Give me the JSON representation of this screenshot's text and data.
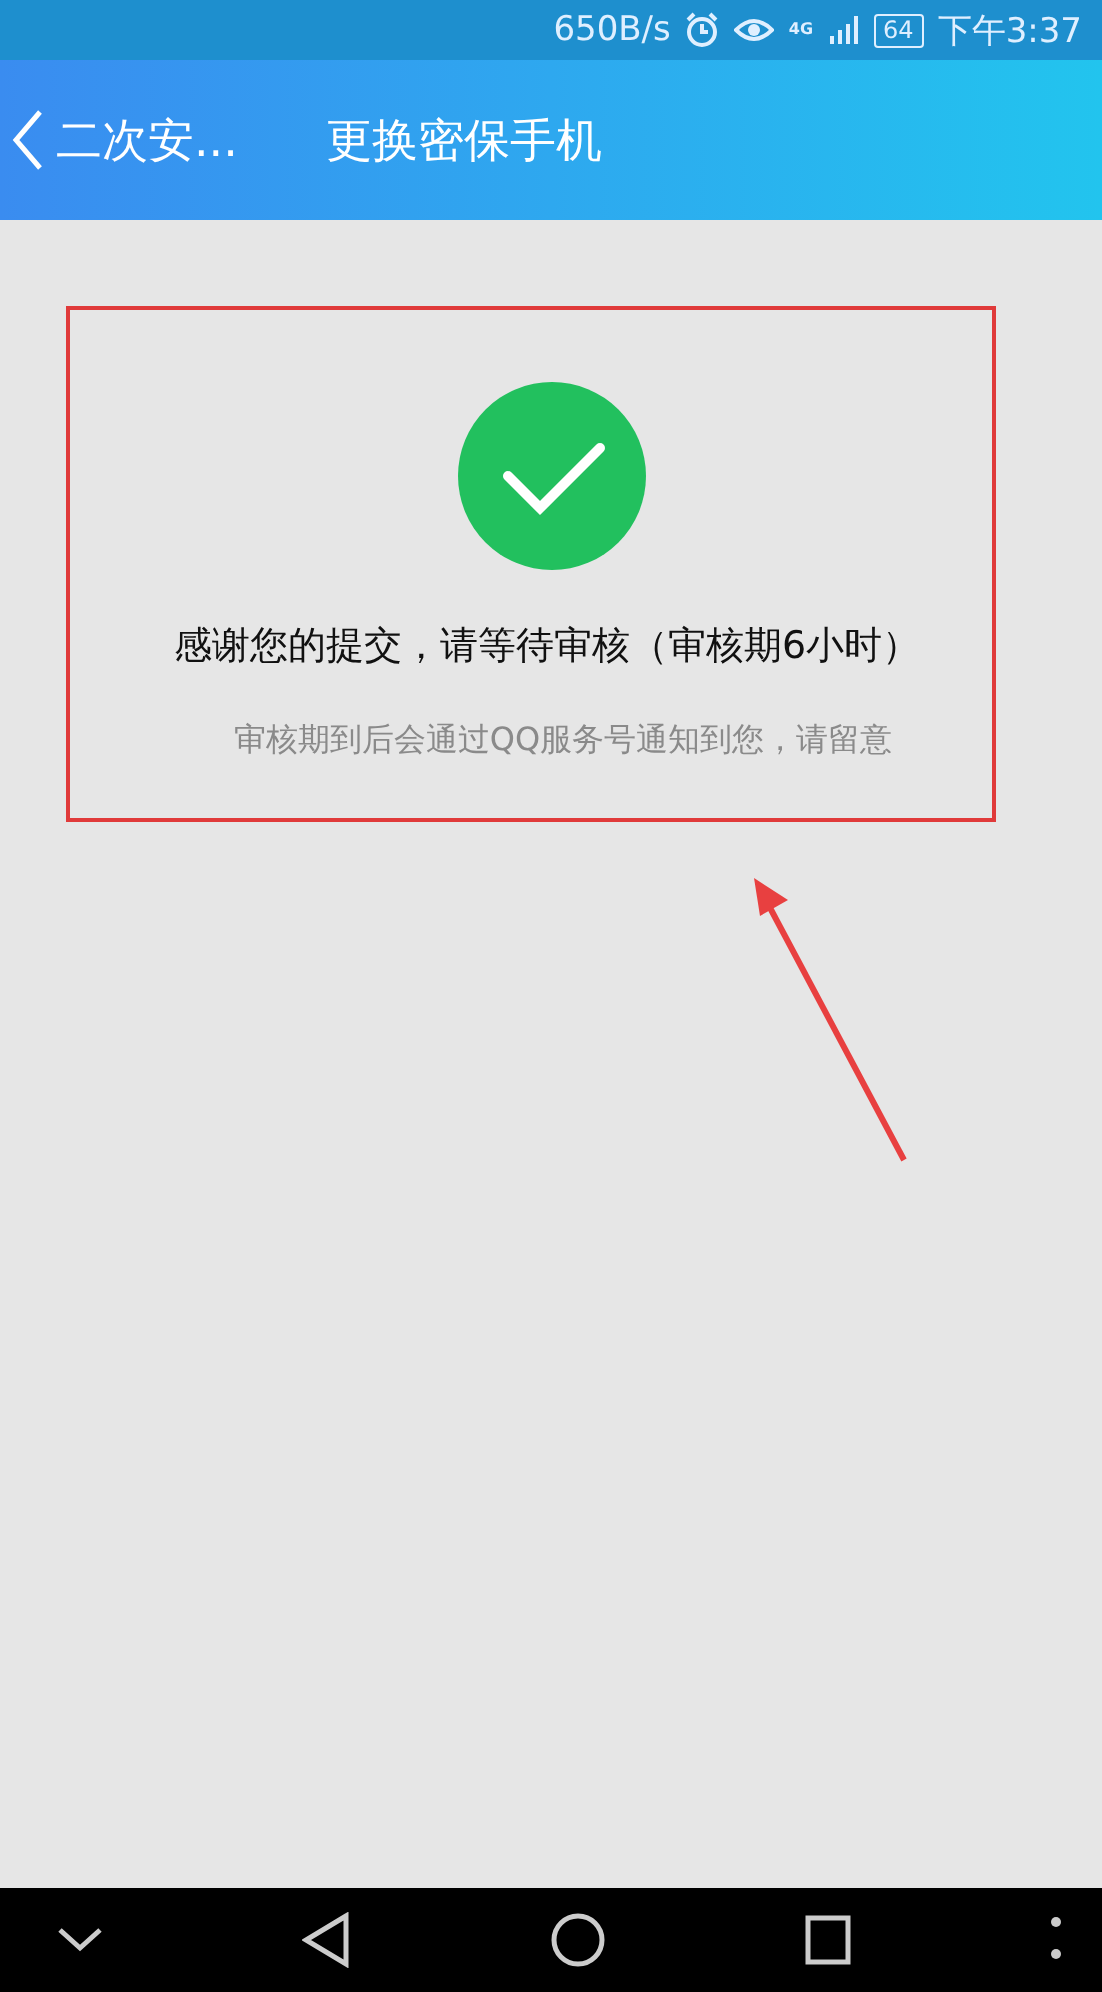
{
  "status_bar": {
    "speed": "650B/s",
    "network": "4G",
    "battery": "64",
    "time": "下午3:37"
  },
  "header": {
    "back_label": "二次安...",
    "title": "更换密保手机"
  },
  "result": {
    "kind": "success",
    "message": "感谢您的提交，请等待审核（审核期6小时）",
    "note": "审核期到后会通过QQ服务号通知到您，请留意"
  },
  "nav_bar": {
    "buttons": [
      {
        "kind": "collapse"
      },
      {
        "kind": "back"
      },
      {
        "kind": "home"
      },
      {
        "kind": "recent"
      },
      {
        "kind": "more"
      }
    ]
  }
}
